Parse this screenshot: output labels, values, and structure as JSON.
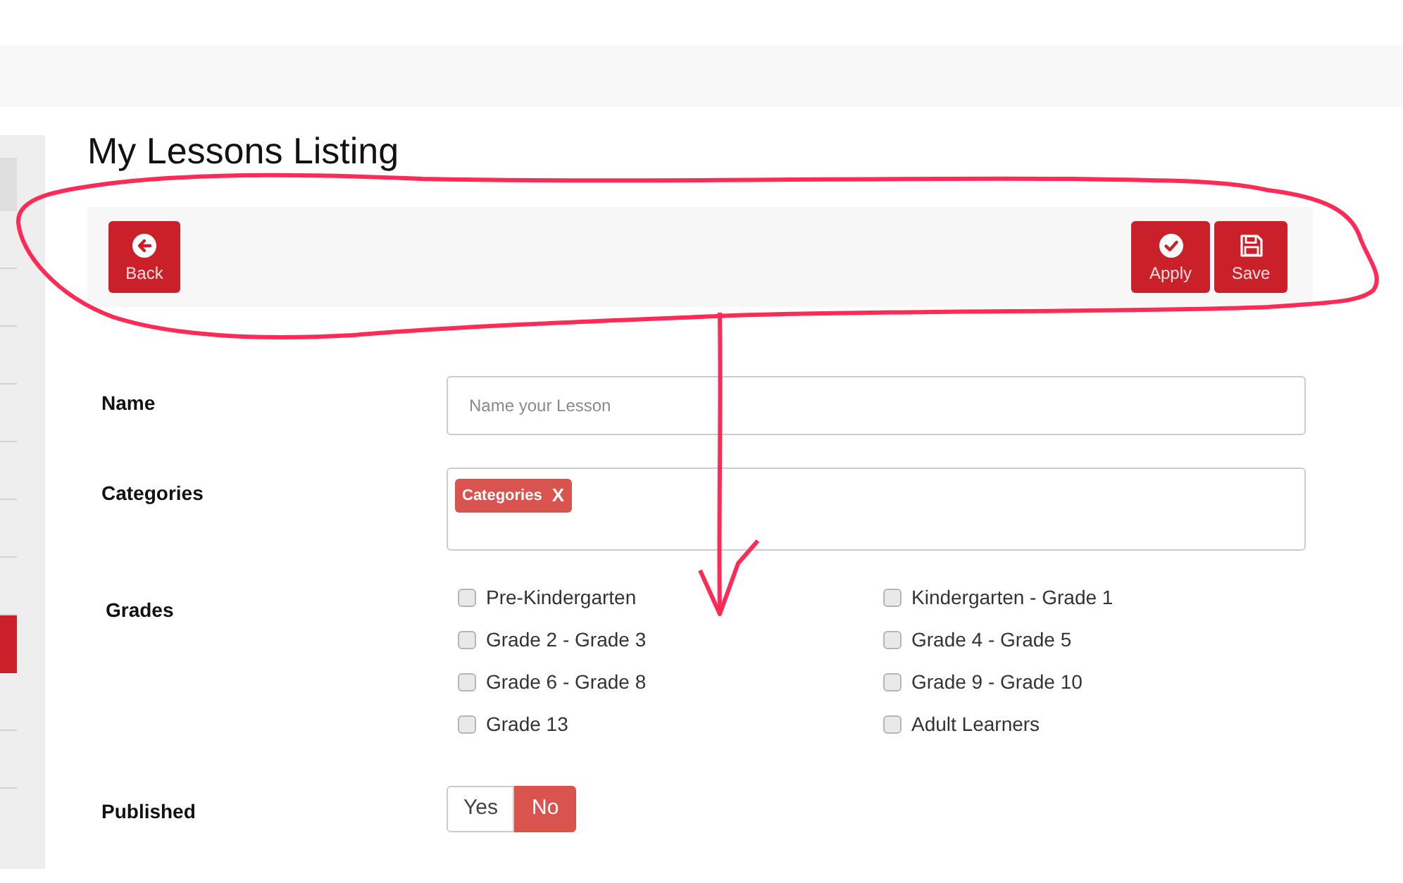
{
  "sidebar": {
    "items": [
      {
        "kind": "header"
      },
      {
        "kind": "item",
        "selected": false
      },
      {
        "kind": "item",
        "selected": false
      },
      {
        "kind": "item",
        "selected": false
      },
      {
        "kind": "item",
        "selected": false
      },
      {
        "kind": "item",
        "selected": false
      },
      {
        "kind": "item",
        "selected": false
      },
      {
        "kind": "item",
        "selected": false
      },
      {
        "kind": "item",
        "selected": true
      },
      {
        "kind": "item",
        "selected": false
      },
      {
        "kind": "item",
        "selected": false
      }
    ]
  },
  "title": "My Lessons Listing",
  "toolbar": {
    "left_buttons": [
      {
        "label": "Back",
        "kind": "back"
      }
    ],
    "right_buttons": [
      {
        "label": "Apply",
        "kind": "apply"
      },
      {
        "label": "Save",
        "kind": "save"
      }
    ]
  },
  "form": {
    "name": {
      "label": "Name",
      "placeholder": "Name your Lesson"
    },
    "categories": {
      "label": "Categories",
      "tags": [
        {
          "label": "Categories",
          "remove": "X"
        }
      ]
    },
    "grades": {
      "label": "Grades",
      "options": [
        {
          "label": "Pre-Kindergarten",
          "checked": false
        },
        {
          "label": "Kindergarten - Grade 1",
          "checked": false
        },
        {
          "label": "Grade 2 - Grade 3",
          "checked": false
        },
        {
          "label": "Grade 4 - Grade 5",
          "checked": false
        },
        {
          "label": "Grade 6 - Grade 8",
          "checked": false
        },
        {
          "label": "Grade 9 - Grade 10",
          "checked": false
        },
        {
          "label": "Grade 13",
          "checked": false
        },
        {
          "label": "Adult Learners",
          "checked": false
        }
      ]
    },
    "published": {
      "label": "Published",
      "options": [
        {
          "label": "Yes",
          "selected": false
        },
        {
          "label": "No",
          "selected": true
        }
      ]
    }
  }
}
